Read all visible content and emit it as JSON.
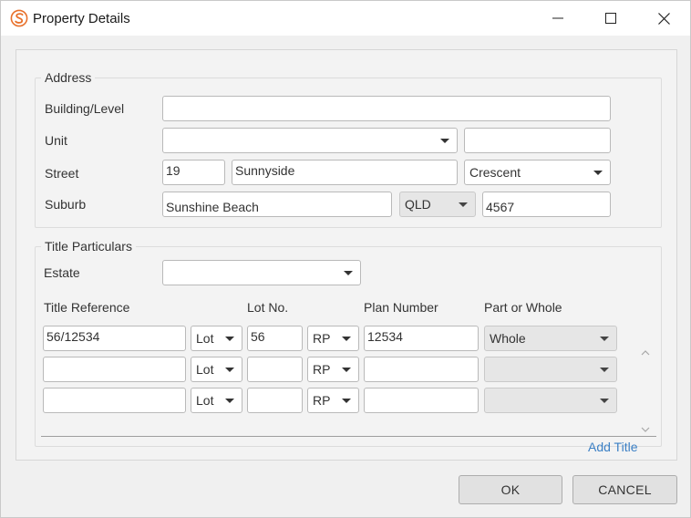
{
  "window": {
    "title": "Property Details",
    "app_icon": "s-logo-icon",
    "controls": [
      "minimize-icon",
      "maximize-icon",
      "close-icon"
    ]
  },
  "address": {
    "legend": "Address",
    "building_level": {
      "label": "Building/Level",
      "value": ""
    },
    "unit": {
      "label": "Unit",
      "select_value": "",
      "value": ""
    },
    "street": {
      "label": "Street",
      "number": "19",
      "name": "Sunnyside",
      "type": "Crescent"
    },
    "suburb": {
      "label": "Suburb",
      "name": "Sunshine Beach",
      "state": "QLD",
      "postcode": "4567"
    }
  },
  "title_particulars": {
    "legend": "Title Particulars",
    "estate": {
      "label": "Estate",
      "value": ""
    },
    "columns": [
      "Title Reference",
      "Lot No.",
      "Plan Number",
      "Part or Whole"
    ],
    "rows": [
      {
        "title_reference": "56/12534",
        "lot_type": "Lot",
        "lot_no": "56",
        "plan_type": "RP",
        "plan_number": "12534",
        "part_or_whole": "Whole"
      },
      {
        "title_reference": "",
        "lot_type": "Lot",
        "lot_no": "",
        "plan_type": "RP",
        "plan_number": "",
        "part_or_whole": ""
      },
      {
        "title_reference": "",
        "lot_type": "Lot",
        "lot_no": "",
        "plan_type": "RP",
        "plan_number": "",
        "part_or_whole": ""
      }
    ],
    "add_title_link": "Add Title"
  },
  "buttons": {
    "ok": "OK",
    "cancel": "CANCEL"
  },
  "colors": {
    "link": "#3c80c5",
    "app_icon": "#e8702a"
  }
}
